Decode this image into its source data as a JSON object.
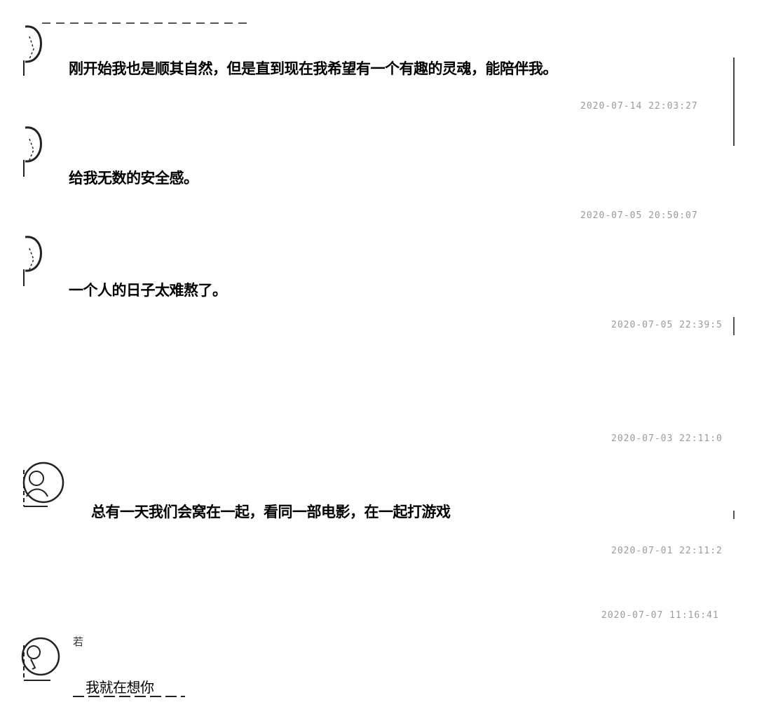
{
  "messages": [
    {
      "text": "刚开始我也是顺其自然，但是直到现在我希望有一个有趣的灵魂，能陪伴我。",
      "timestamp": "2020-07-14 22:03:27"
    },
    {
      "text": "给我无数的安全感。",
      "timestamp": "2020-07-05 20:50:07"
    },
    {
      "text": "一个人的日子太难熬了。",
      "timestamp": "2020-07-05 22:39:5"
    },
    {
      "text": "",
      "timestamp": "2020-07-03 22:11:0"
    },
    {
      "text": "总有一天我们会窝在一起，看同一部电影，在一起打游戏",
      "timestamp": "2020-07-01 22:11:2"
    },
    {
      "name_fragment": "若",
      "text": "我就在想你",
      "timestamp": "2020-07-07 11:16:41"
    }
  ],
  "icons": {
    "avatar": "user-avatar-icon"
  }
}
